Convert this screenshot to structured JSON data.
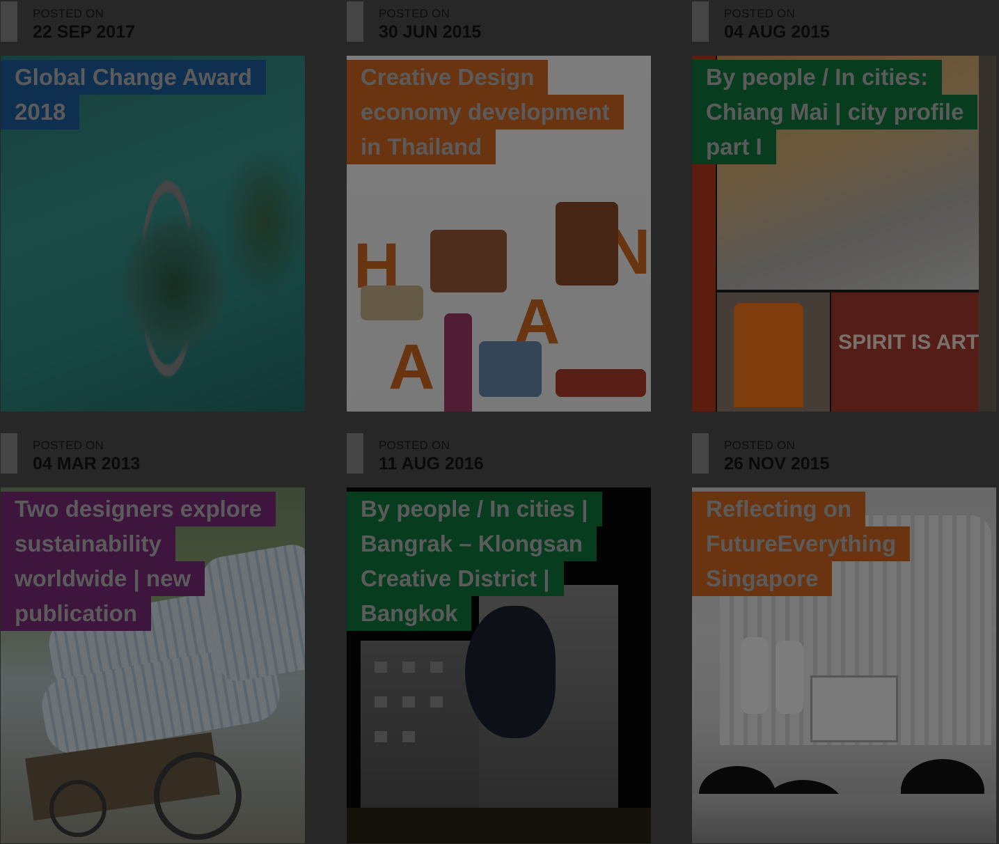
{
  "posts": [
    {
      "posted_label": "POSTED ON",
      "date": "22 SEP 2017",
      "title_lines": [
        "Global Change Award",
        "2018"
      ],
      "title_color": "#1f5fa0"
    },
    {
      "posted_label": "POSTED ON",
      "date": "30 JUN 2015",
      "title_lines": [
        "Creative Design",
        "economy development",
        "in Thailand"
      ],
      "title_color": "#d2691e"
    },
    {
      "posted_label": "POSTED ON",
      "date": "04 AUG 2015",
      "title_lines": [
        "By people / In cities:",
        "Chiang Mai | city profile",
        "part I"
      ],
      "title_color": "#0f7a3c"
    },
    {
      "posted_label": "POSTED ON",
      "date": "04 MAR 2013",
      "title_lines": [
        "Two designers explore",
        "sustainability",
        "worldwide | new",
        "publication"
      ],
      "title_color": "#7b2a7a"
    },
    {
      "posted_label": "POSTED ON",
      "date": "11 AUG 2016",
      "title_lines": [
        "By people / In cities |",
        "Bangrak – Klongsan",
        "Creative District |",
        "Bangkok"
      ],
      "title_color": "#0f7a3c"
    },
    {
      "posted_label": "POSTED ON",
      "date": "26 NOV 2015",
      "title_lines": [
        "Reflecting on",
        "FutureEverything",
        "Singapore"
      ],
      "title_color": "#d2691e"
    }
  ]
}
